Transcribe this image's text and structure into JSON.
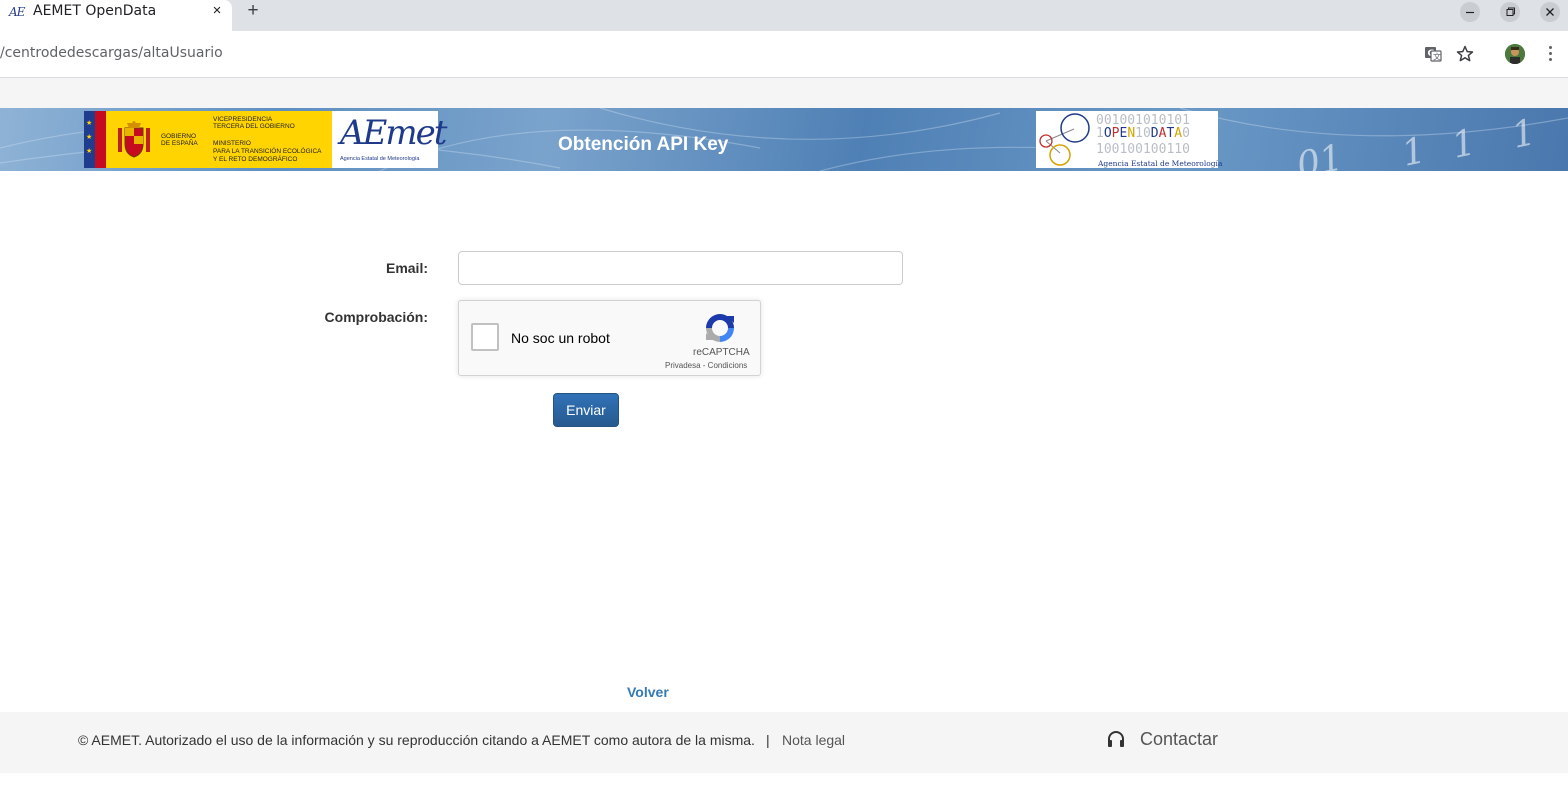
{
  "browser": {
    "tab_title": "AEMET OpenData",
    "tab_favicon_text": "AE",
    "new_tab_glyph": "+",
    "close_glyph": "×",
    "url": "/centrodedescargas/altaUsuario",
    "icons": [
      "translate-icon",
      "bookmark-star-icon",
      "profile-avatar",
      "more-menu-icon"
    ],
    "window_controls": [
      "minimize",
      "restore",
      "close"
    ]
  },
  "banner": {
    "title": "Obtención API Key",
    "gobierno": {
      "line1": "GOBIERNO",
      "line2": "DE ESPAÑA",
      "vp1": "VICEPRESIDENCIA",
      "vp2": "TERCERA DEL GOBIERNO",
      "min1": "MINISTERIO",
      "min2": "PARA LA TRANSICIÓN ECOLÓGICA",
      "min3": "Y EL RETO DEMOGRÁFICO"
    },
    "aemet": {
      "mark": "AEmet",
      "subtitle": "Agencia Estatal de Meteorología"
    },
    "opendata": {
      "bits_top": "001001010101",
      "word": "1OPEN10DATA0",
      "bits_bottom": "100100100110",
      "subtitle": "Agencia Estatal de Meteorología"
    }
  },
  "form": {
    "email_label": "Email:",
    "email_value": "",
    "check_label": "Comprobación:",
    "recaptcha": {
      "label": "No soc un robot",
      "brand": "reCAPTCHA",
      "terms": "Privadesa - Condicions"
    },
    "submit_label": "Enviar"
  },
  "back_link": "Volver",
  "footer": {
    "copyright": "© AEMET. Autorizado el uso de la información y su reproducción citando a AEMET como autora de la misma.",
    "separator": "|",
    "legal": "Nota legal",
    "contact": "Contactar"
  },
  "colors": {
    "link": "#337ab7",
    "button": "#286090",
    "footer_bg": "#f5f5f5"
  }
}
